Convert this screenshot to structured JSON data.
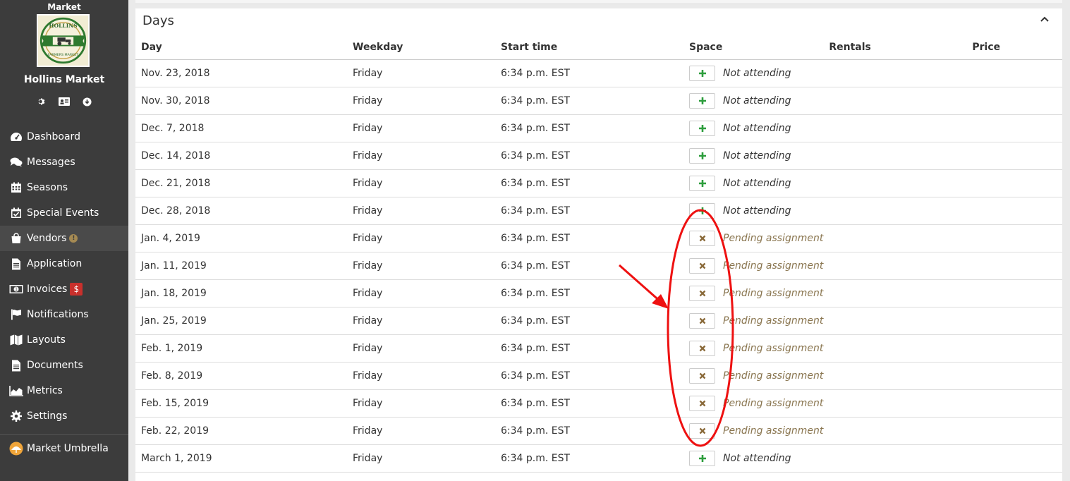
{
  "sidebar": {
    "label": "Market",
    "market_name": "Hollins Market",
    "logo_text_top": "HOLLINS",
    "logo_text_bottom": "FARMERS MARKET",
    "icons": [
      "gear-icon",
      "id-card-icon",
      "download-circle-icon"
    ],
    "nav": [
      {
        "label": "Dashboard",
        "icon": "dashboard-icon"
      },
      {
        "label": "Messages",
        "icon": "comments-icon"
      },
      {
        "label": "Seasons",
        "icon": "calendar-icon"
      },
      {
        "label": "Special Events",
        "icon": "calendar-check-icon"
      },
      {
        "label": "Vendors",
        "icon": "shopping-bag-icon",
        "badge": "!"
      },
      {
        "label": "Application",
        "icon": "file-icon"
      },
      {
        "label": "Invoices",
        "icon": "money-icon",
        "badge": "$"
      },
      {
        "label": "Notifications",
        "icon": "flag-icon"
      },
      {
        "label": "Layouts",
        "icon": "map-icon"
      },
      {
        "label": "Documents",
        "icon": "file-icon"
      },
      {
        "label": "Metrics",
        "icon": "area-chart-icon"
      },
      {
        "label": "Settings",
        "icon": "gear-icon"
      }
    ],
    "footer_item": {
      "label": "Market Umbrella",
      "icon": "umbrella-logo-icon"
    }
  },
  "panel": {
    "title": "Days",
    "columns": {
      "day": "Day",
      "weekday": "Weekday",
      "start": "Start time",
      "space": "Space",
      "rentals": "Rentals",
      "price": "Price"
    },
    "rows": [
      {
        "day": "Nov. 23, 2018",
        "weekday": "Friday",
        "start": "6:34 p.m. EST",
        "status": "Not attending",
        "kind": "add"
      },
      {
        "day": "Nov. 30, 2018",
        "weekday": "Friday",
        "start": "6:34 p.m. EST",
        "status": "Not attending",
        "kind": "add"
      },
      {
        "day": "Dec. 7, 2018",
        "weekday": "Friday",
        "start": "6:34 p.m. EST",
        "status": "Not attending",
        "kind": "add"
      },
      {
        "day": "Dec. 14, 2018",
        "weekday": "Friday",
        "start": "6:34 p.m. EST",
        "status": "Not attending",
        "kind": "add"
      },
      {
        "day": "Dec. 21, 2018",
        "weekday": "Friday",
        "start": "6:34 p.m. EST",
        "status": "Not attending",
        "kind": "add"
      },
      {
        "day": "Dec. 28, 2018",
        "weekday": "Friday",
        "start": "6:34 p.m. EST",
        "status": "Not attending",
        "kind": "add"
      },
      {
        "day": "Jan. 4, 2019",
        "weekday": "Friday",
        "start": "6:34 p.m. EST",
        "status": "Pending assignment",
        "kind": "remove"
      },
      {
        "day": "Jan. 11, 2019",
        "weekday": "Friday",
        "start": "6:34 p.m. EST",
        "status": "Pending assignment",
        "kind": "remove"
      },
      {
        "day": "Jan. 18, 2019",
        "weekday": "Friday",
        "start": "6:34 p.m. EST",
        "status": "Pending assignment",
        "kind": "remove"
      },
      {
        "day": "Jan. 25, 2019",
        "weekday": "Friday",
        "start": "6:34 p.m. EST",
        "status": "Pending assignment",
        "kind": "remove"
      },
      {
        "day": "Feb. 1, 2019",
        "weekday": "Friday",
        "start": "6:34 p.m. EST",
        "status": "Pending assignment",
        "kind": "remove"
      },
      {
        "day": "Feb. 8, 2019",
        "weekday": "Friday",
        "start": "6:34 p.m. EST",
        "status": "Pending assignment",
        "kind": "remove"
      },
      {
        "day": "Feb. 15, 2019",
        "weekday": "Friday",
        "start": "6:34 p.m. EST",
        "status": "Pending assignment",
        "kind": "remove"
      },
      {
        "day": "Feb. 22, 2019",
        "weekday": "Friday",
        "start": "6:34 p.m. EST",
        "status": "Pending assignment",
        "kind": "remove"
      },
      {
        "day": "March 1, 2019",
        "weekday": "Friday",
        "start": "6:34 p.m. EST",
        "status": "Not attending",
        "kind": "add"
      }
    ]
  },
  "colors": {
    "sidebar_bg": "#3c3c3c",
    "add_green": "#2e9e3e",
    "remove_brown": "#8a6a3a",
    "pending_text": "#8a7650",
    "invoice_badge": "#c9302c",
    "annotation_red": "#ee1111"
  }
}
